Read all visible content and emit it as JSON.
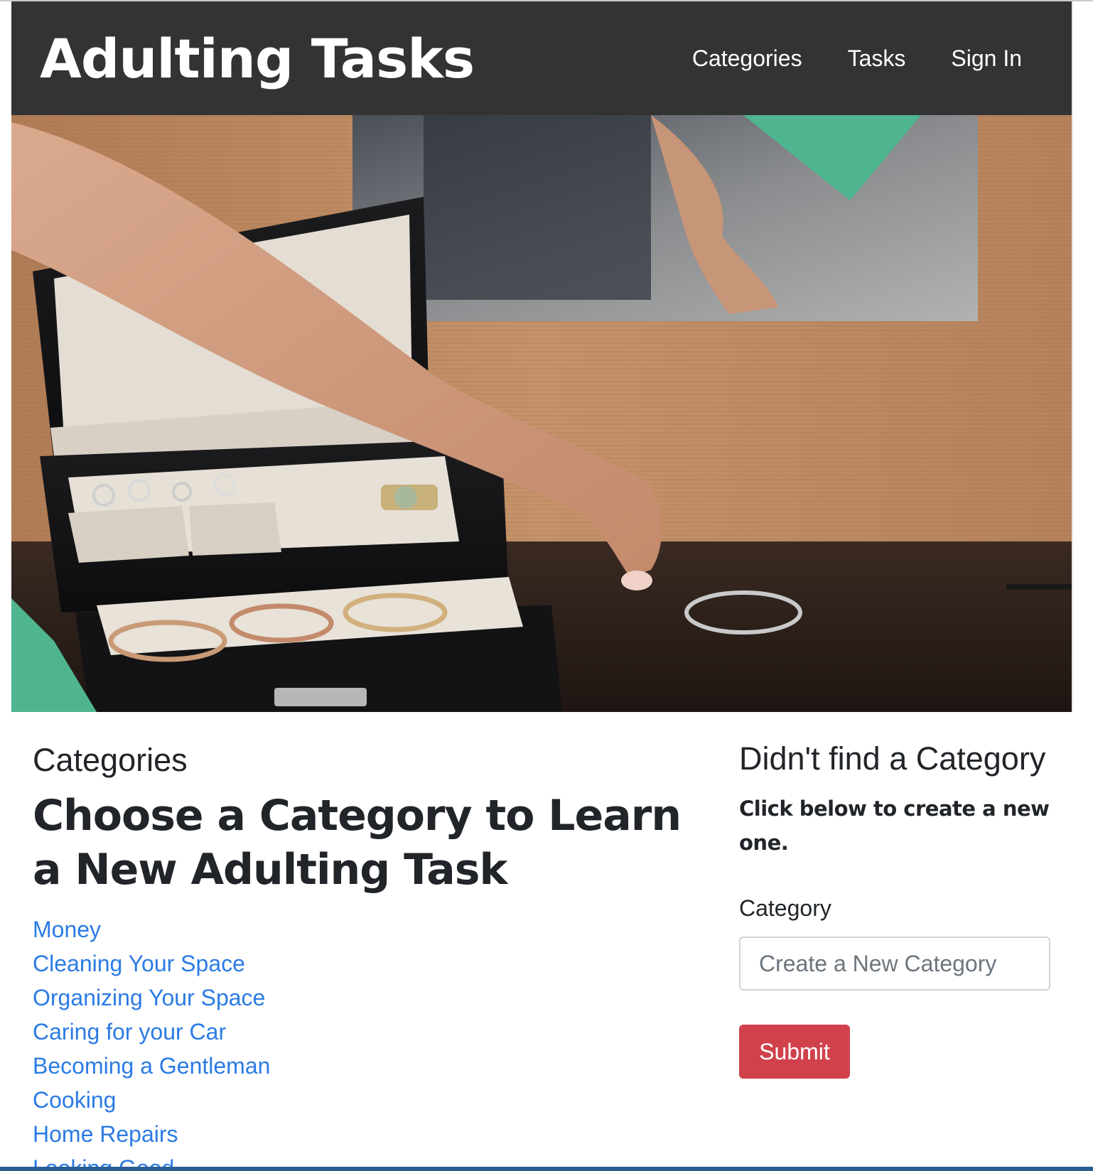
{
  "navbar": {
    "brand": "Adulting Tasks",
    "links": [
      "Categories",
      "Tasks",
      "Sign In"
    ]
  },
  "hero": {
    "image": "jewelry-box-photo"
  },
  "categories": {
    "label": "Categories",
    "heading": "Choose a Category to Learn a New Adulting Task",
    "items": [
      "Money",
      "Cleaning Your Space",
      "Organizing Your Space",
      "Caring for your Car",
      "Becoming a Gentleman",
      "Cooking",
      "Home Repairs",
      "Looking Good"
    ]
  },
  "create_category": {
    "heading": "Didn't find a Category",
    "subheading": "Click below to create a new one.",
    "field_label": "Category",
    "placeholder": "Create a New Category",
    "value": "",
    "submit_label": "Submit"
  },
  "colors": {
    "navbar_bg": "#333333",
    "link": "#2b7be4",
    "submit_bg": "#d0414c",
    "text": "#212529"
  }
}
